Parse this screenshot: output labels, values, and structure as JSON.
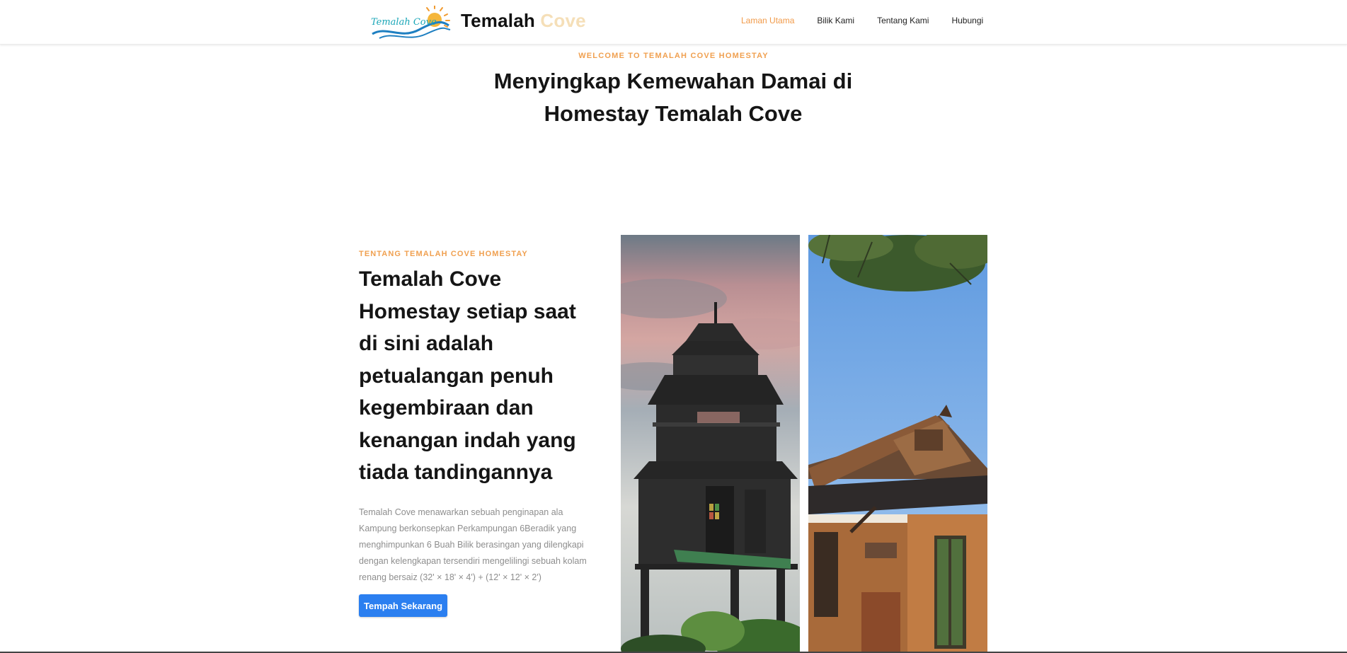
{
  "header": {
    "logo_text": "Temalah Cove",
    "brand_name": "Temalah",
    "brand_accent": "Cove",
    "nav": [
      {
        "label": "Laman Utama",
        "active": true
      },
      {
        "label": "Bilik Kami",
        "active": false
      },
      {
        "label": "Tentang Kami",
        "active": false
      },
      {
        "label": "Hubungi",
        "active": false
      }
    ]
  },
  "hero": {
    "eyebrow": "WELCOME TO TEMALAH COVE HOMESTAY",
    "title": "Menyingkap Kemewahan Damai di Homestay Temalah Cove"
  },
  "about": {
    "eyebrow": "TENTANG TEMALAH COVE HOMESTAY",
    "title": "Temalah Cove Homestay setiap saat di sini adalah petualangan penuh kegembiraan dan kenangan indah yang tiada tandingannya",
    "description": "Temalah Cove menawarkan sebuah penginapan ala Kampung berkonsepkan Perkampungan 6Beradik yang menghimpunkan 6 Buah Bilik berasingan yang dilengkapi dengan kelengkapan tersendiri mengelilingi sebuah kolam renang bersaiz (32' × 18' × 4') + (12' × 12' × 2')",
    "cta_label": "Tempah Sekarang"
  },
  "colors": {
    "accent_orange": "#f0a050",
    "brand_accent": "#f5dfb8",
    "button_blue": "#2b7ff0",
    "desc_gray": "#8e8e8e"
  },
  "images": [
    {
      "name": "tower-photo"
    },
    {
      "name": "house-photo"
    }
  ]
}
